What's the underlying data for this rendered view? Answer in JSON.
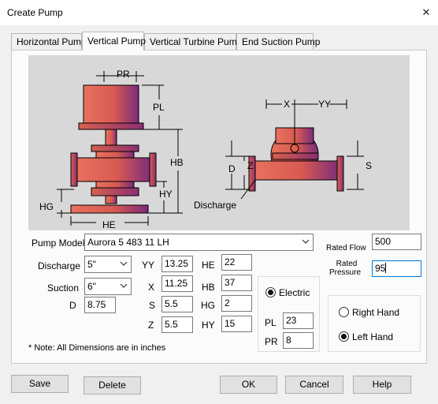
{
  "window": {
    "title": "Create Pump",
    "close_glyph": "✕"
  },
  "tabs": [
    {
      "label": "Horizontal Pump",
      "active": false
    },
    {
      "label": "Vertical Pump",
      "active": true
    },
    {
      "label": "Vertical Turbine Pump",
      "active": false
    },
    {
      "label": "End Suction Pump",
      "active": false
    }
  ],
  "diagram": {
    "labels": {
      "pr": "PR",
      "pl": "PL",
      "hb": "HB",
      "hy": "HY",
      "hg": "HG",
      "he": "HE",
      "x": "X",
      "yy": "YY",
      "d": "D",
      "z": "Z",
      "s": "S",
      "discharge": "Discharge"
    },
    "pump_color": "#e06050"
  },
  "form": {
    "pump_model": {
      "label": "Pump Model",
      "value": "Aurora 5 483 11 LH"
    },
    "discharge": {
      "label": "Discharge",
      "value": "5\""
    },
    "suction": {
      "label": "Suction",
      "value": "6\""
    },
    "d": {
      "label": "D",
      "value": "8.75"
    },
    "yy": {
      "label": "YY",
      "value": "13.25"
    },
    "x": {
      "label": "X",
      "value": "11.25"
    },
    "s": {
      "label": "S",
      "value": "5.5"
    },
    "z": {
      "label": "Z",
      "value": "5.5"
    },
    "he": {
      "label": "HE",
      "value": "22"
    },
    "hb": {
      "label": "HB",
      "value": "37"
    },
    "hg": {
      "label": "HG",
      "value": "2"
    },
    "hy": {
      "label": "HY",
      "value": "15"
    },
    "rated_flow": {
      "label": "Rated Flow",
      "value": "500"
    },
    "rated_pressure": {
      "label_line1": "Rated",
      "label_line2": "Pressure",
      "value": "95"
    },
    "note": "* Note: All Dimensions are in inches"
  },
  "motor": {
    "electric": {
      "label": "Electric",
      "selected": true
    },
    "pl": {
      "label": "PL",
      "value": "23"
    },
    "pr": {
      "label": "PR",
      "value": "8"
    }
  },
  "hand": {
    "right": {
      "label": "Right Hand",
      "selected": false
    },
    "left": {
      "label": "Left Hand",
      "selected": true
    }
  },
  "buttons": {
    "save": "Save",
    "delete": "Delete",
    "ok": "OK",
    "cancel": "Cancel",
    "help": "Help"
  }
}
